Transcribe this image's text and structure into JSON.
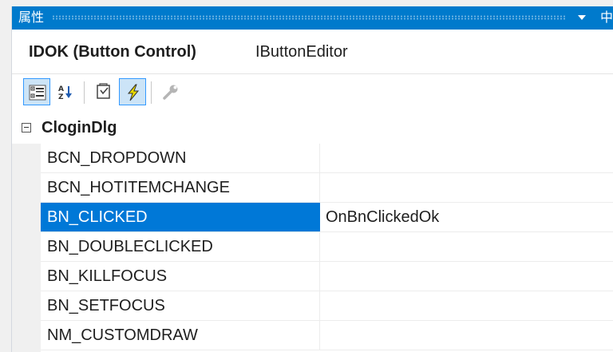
{
  "window": {
    "title": "属性",
    "pin_glyph": "中",
    "dropdown_icon": "dropdown-arrow-icon"
  },
  "object": {
    "name": "IDOK (Button Control)",
    "type": "IButtonEditor"
  },
  "toolbar": {
    "buttons": [
      {
        "icon": "categorized-icon",
        "active": true
      },
      {
        "icon": "alphabetical-sort-icon",
        "active": false
      },
      {
        "icon": "properties-icon",
        "active": false
      },
      {
        "icon": "control-events-icon",
        "active": true
      },
      {
        "icon": "property-pages-icon",
        "active": false,
        "disabled": true
      }
    ]
  },
  "grid": {
    "category": "CloginDlg",
    "rows": [
      {
        "name": "BCN_DROPDOWN",
        "value": ""
      },
      {
        "name": "BCN_HOTITEMCHANGE",
        "value": ""
      },
      {
        "name": "BN_CLICKED",
        "value": "OnBnClickedOk",
        "selected": true
      },
      {
        "name": "BN_DOUBLECLICKED",
        "value": ""
      },
      {
        "name": "BN_KILLFOCUS",
        "value": ""
      },
      {
        "name": "BN_SETFOCUS",
        "value": ""
      },
      {
        "name": "NM_CUSTOMDRAW",
        "value": ""
      }
    ]
  },
  "colors": {
    "titlebar": "#007acc",
    "selection": "#0078d7",
    "toolbar_active_bg": "#cce4f7",
    "toolbar_active_border": "#3399ff",
    "lightning": "#e8d900"
  }
}
